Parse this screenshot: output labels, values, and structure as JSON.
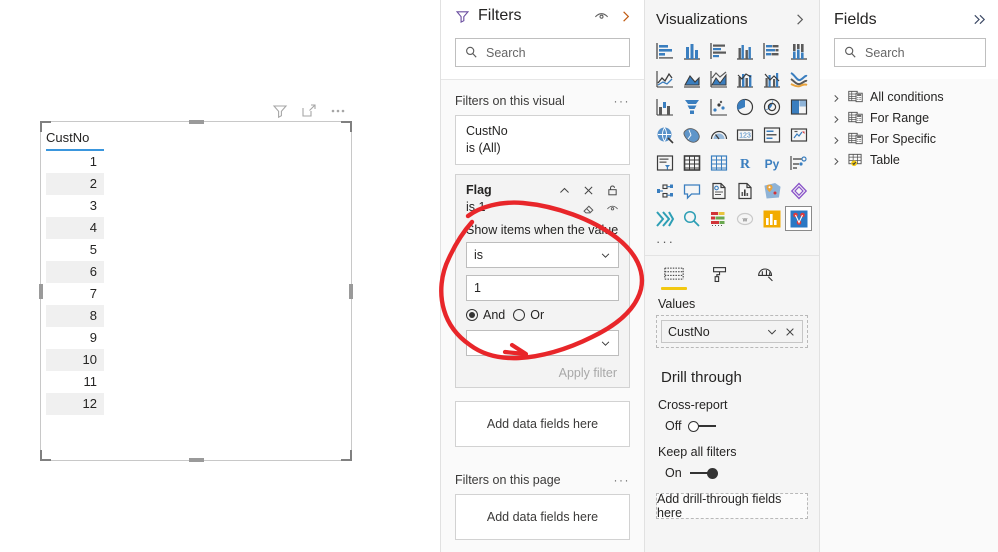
{
  "canvas": {
    "visual_header_icons": [
      "filter-icon",
      "focus-mode-icon",
      "more-options-icon"
    ],
    "table": {
      "column_header": "CustNo",
      "rows": [
        "1",
        "2",
        "3",
        "4",
        "5",
        "6",
        "7",
        "8",
        "9",
        "10",
        "11",
        "12"
      ]
    }
  },
  "filters": {
    "title": "Filters",
    "header_icons": [
      "eye-icon",
      "chevron-right-icon"
    ],
    "search": {
      "placeholder": "Search"
    },
    "visual_section": {
      "label": "Filters on this visual",
      "more": "···"
    },
    "cards": [
      {
        "title": "CustNo",
        "subtitle": "is (All)"
      }
    ],
    "active_card": {
      "title": "Flag",
      "subtitle": "is 1",
      "icons": [
        "chevron-up-icon",
        "close-icon",
        "lock-icon",
        "eraser-icon",
        "eye-icon"
      ],
      "field_label": "Show items when the value",
      "operator": "is",
      "value": "1",
      "radio_and": "And",
      "radio_or": "Or",
      "selected_radio": "And",
      "second_operator": "",
      "apply_label": "Apply filter"
    },
    "visual_dropzone": "Add data fields here",
    "page_section": {
      "label": "Filters on this page",
      "more": "···"
    },
    "page_dropzone": "Add data fields here"
  },
  "visualizations": {
    "title": "Visualizations",
    "collapse_icon": "chevron-right-icon",
    "icons": [
      "stacked-bar-chart-icon",
      "stacked-column-chart-icon",
      "clustered-bar-chart-icon",
      "clustered-column-chart-icon",
      "100-stacked-bar-chart-icon",
      "100-stacked-column-chart-icon",
      "line-chart-icon",
      "area-chart-icon",
      "stacked-area-chart-icon",
      "line-stacked-column-chart-icon",
      "line-clustered-column-chart-icon",
      "ribbon-chart-icon",
      "waterfall-chart-icon",
      "funnel-chart-icon",
      "scatter-chart-icon",
      "pie-chart-icon",
      "donut-chart-icon",
      "treemap-icon",
      "map-icon",
      "filled-map-icon",
      "gauge-icon",
      "card-icon",
      "multi-row-card-icon",
      "kpi-icon",
      "slicer-icon",
      "table-icon",
      "matrix-icon",
      "r-script-visual-icon",
      "python-visual-icon",
      "key-influencers-icon",
      "decomposition-tree-icon",
      "qa-visual-icon",
      "paginated-report-icon",
      "smart-narrative-icon",
      "arcgis-map-icon",
      "power-apps-icon",
      "drill-down-icon",
      "search-visual-icon",
      "bullet-chart-icon",
      "word-cloud-icon",
      "chiclet-slicer-icon",
      "network-chart-icon"
    ],
    "selected_icon_index": 41,
    "more_icon": "···",
    "format_tabs": [
      {
        "name": "fields-tab",
        "icon": "fields-pane-icon",
        "active": true
      },
      {
        "name": "format-tab",
        "icon": "paint-roller-icon",
        "active": false
      },
      {
        "name": "analytics-tab",
        "icon": "analytics-magnifier-icon",
        "active": false
      }
    ],
    "values_label": "Values",
    "values_field": "CustNo",
    "drill_through": {
      "title": "Drill through",
      "cross_report_label": "Cross-report",
      "cross_report_state": "Off",
      "keep_all_filters_label": "Keep all filters",
      "keep_all_filters_state": "On",
      "dropzone": "Add drill-through fields here"
    }
  },
  "fields": {
    "title": "Fields",
    "collapse_icon": "double-chevron-right-icon",
    "search": {
      "placeholder": "Search"
    },
    "items": [
      {
        "label": "All conditions",
        "icon": "measure-table-icon"
      },
      {
        "label": "For Range",
        "icon": "measure-table-icon"
      },
      {
        "label": "For Specific",
        "icon": "measure-table-icon"
      },
      {
        "label": "Table",
        "icon": "table-checked-icon"
      }
    ]
  },
  "annotation": {
    "shape": "hand-drawn-oval-with-arrow",
    "color": "#e8262a"
  }
}
